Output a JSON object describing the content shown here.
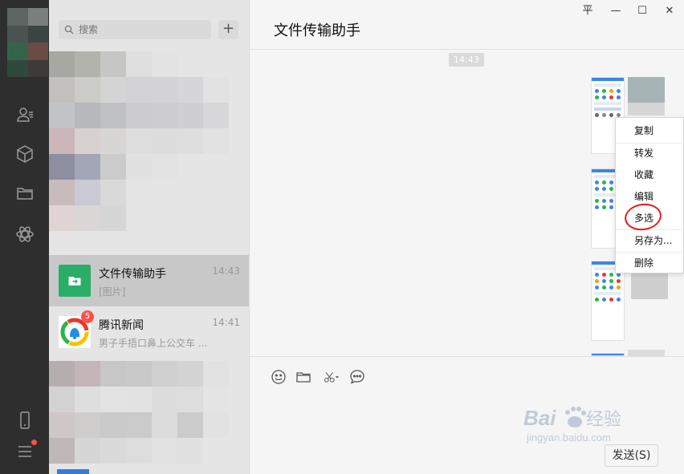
{
  "search": {
    "placeholder": "搜索"
  },
  "chats": [
    {
      "title": "文件传输助手",
      "time": "14:43",
      "preview": "[图片]",
      "active": true
    },
    {
      "title": "腾讯新闻",
      "time": "14:41",
      "preview": "男子手捂口鼻上公交车 ...",
      "badge": "5",
      "active": false
    }
  ],
  "conversation": {
    "title": "文件传输助手",
    "timestamp": "14:43"
  },
  "window_controls": {
    "pin": "平",
    "minimize": "—",
    "maximize": "☐",
    "close": "✕"
  },
  "context_menu": [
    "复制",
    "转发",
    "收藏",
    "编辑",
    "多选",
    "另存为...",
    "删除"
  ],
  "input": {
    "send_label": "发送(S)"
  },
  "watermark": {
    "brand": "Baidu经验",
    "url": "jingyan.baidu.com"
  },
  "colors": {
    "rail": "#2e2e2e",
    "list_bg": "#e6e5e5",
    "active_item": "#c9c8c8",
    "main_bg": "#f5f5f5",
    "badge": "#fa5151",
    "file_helper_icon": "#2aae67",
    "annotation": "#e02020"
  }
}
